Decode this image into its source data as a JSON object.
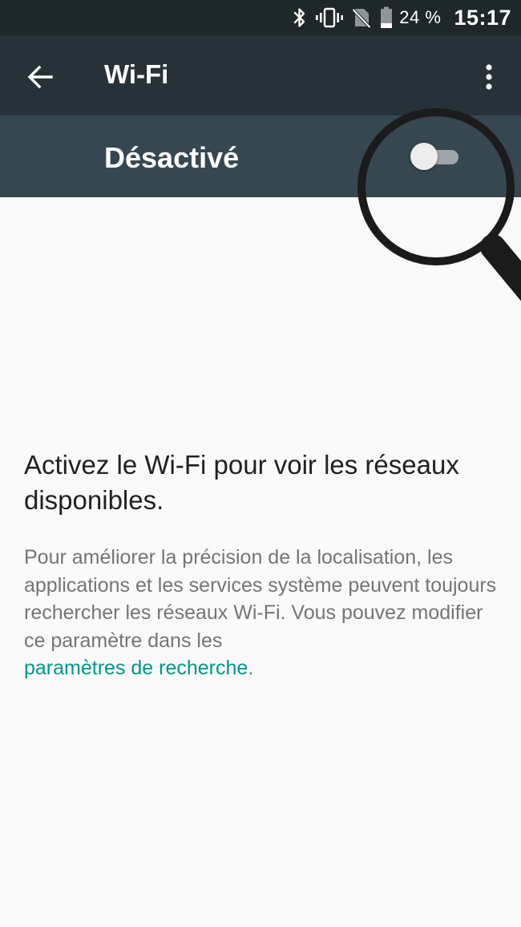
{
  "status_bar": {
    "icons": [
      "bluetooth-icon",
      "vibrate-icon",
      "no-sim-icon",
      "battery-icon"
    ],
    "battery_percent": "24 %",
    "time": "15:17"
  },
  "app_bar": {
    "back_icon": "arrow-back-icon",
    "title": "Wi-Fi",
    "menu_icon": "more-vert-icon"
  },
  "wifi_switch": {
    "label": "Désactivé",
    "state": "off"
  },
  "content": {
    "heading": "Activez le Wi-Fi pour voir les réseaux disponibles.",
    "description": "Pour améliorer la précision de la localisation, les applications et les services système peuvent toujours rechercher les réseaux Wi-Fi. Vous pouvez modifier ce paramètre dans les",
    "link_text": "paramètres de recherche",
    "trailing": "."
  },
  "colors": {
    "status_bar": "#1e272c",
    "app_bar": "#263238",
    "switch_bar": "#37474f",
    "background": "#fafafa",
    "link": "#009688"
  }
}
